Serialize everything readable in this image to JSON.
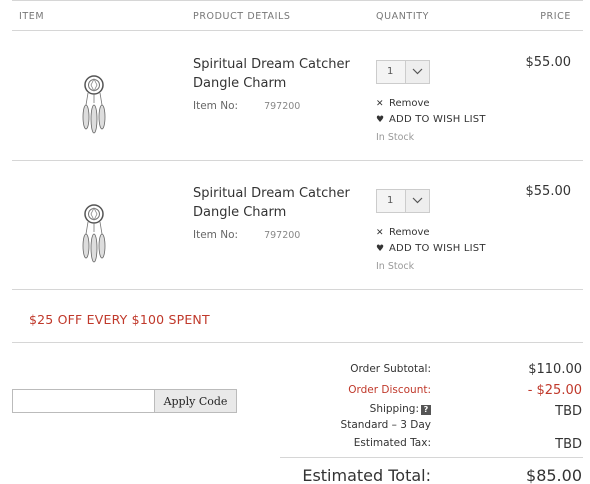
{
  "header": {
    "item": "ITEM",
    "details": "PRODUCT DETAILS",
    "quantity": "QUANTITY",
    "price": "PRICE"
  },
  "items": [
    {
      "name": "Spiritual Dream Catcher Dangle Charm",
      "item_no_label": "Item No:",
      "item_no": "797200",
      "qty": "1",
      "remove": "Remove",
      "wishlist": "ADD TO WISH LIST",
      "stock": "In Stock",
      "price": "$55.00",
      "icon": "dream-catcher-charm-image"
    },
    {
      "name": "Spiritual Dream Catcher Dangle Charm",
      "item_no_label": "Item No:",
      "item_no": "797200",
      "qty": "1",
      "remove": "Remove",
      "wishlist": "ADD TO WISH LIST",
      "stock": "In Stock",
      "price": "$55.00",
      "icon": "dream-catcher-charm-image"
    }
  ],
  "promo": "$25 OFF EVERY $100 SPENT",
  "promo_code": {
    "value": "",
    "apply_label": "Apply Code"
  },
  "summary": {
    "subtotal_label": "Order Subtotal:",
    "subtotal": "$110.00",
    "discount_label": "Order Discount:",
    "discount": "- $25.00",
    "shipping_label": "Shipping:",
    "shipping_help": "?",
    "shipping_method": "Standard – 3 Day",
    "shipping": "TBD",
    "tax_label": "Estimated Tax:",
    "tax": "TBD",
    "total_label": "Estimated Total:",
    "total": "$85.00"
  },
  "colors": {
    "accent": "#c0392b",
    "border": "#d6d6d6"
  }
}
